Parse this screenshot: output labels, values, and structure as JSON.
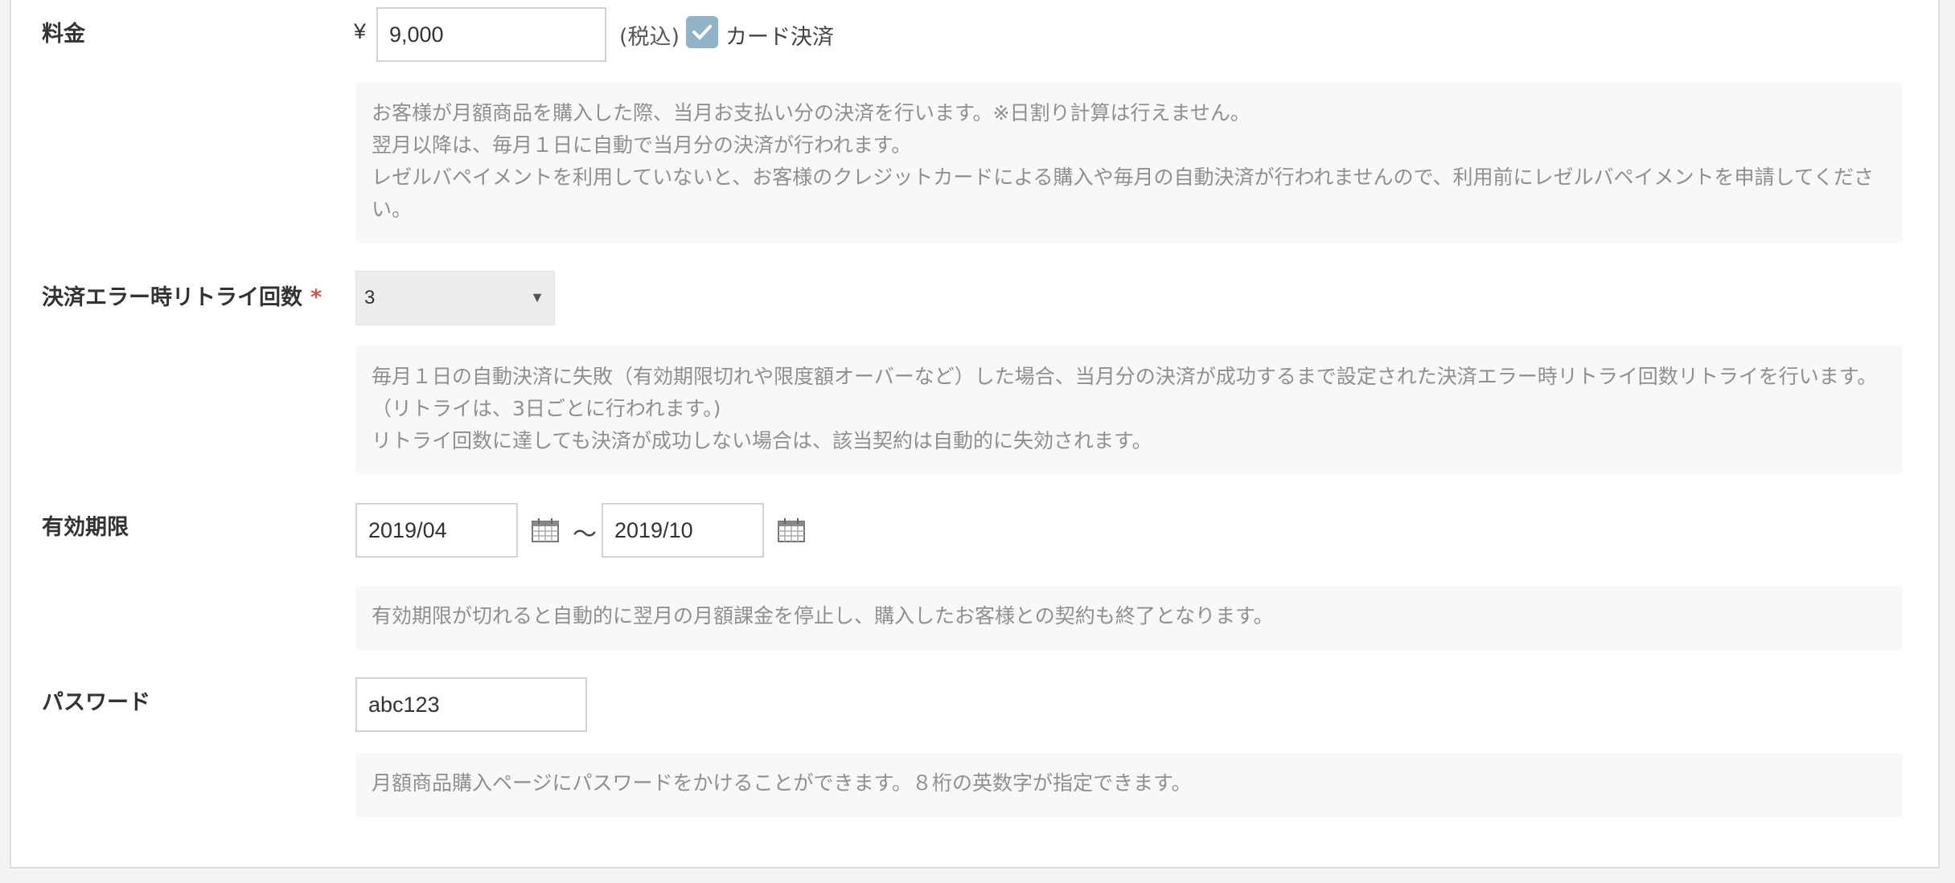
{
  "fee": {
    "label": "料金",
    "currency": "¥",
    "value": "9,000",
    "tax_note": "(税込)",
    "card_label": "カード決済",
    "card_checked": true,
    "help": [
      "お客様が月額商品を購入した際、当月お支払い分の決済を行います。※日割り計算は行えません。",
      "翌月以降は、毎月１日に自動で当月分の決済が行われます。",
      "レゼルバペイメントを利用していないと、お客様のクレジットカードによる購入や毎月の自動決済が行われませんので、利用前にレゼルバペイメントを申請してください。"
    ]
  },
  "retry": {
    "label": "決済エラー時リトライ回数",
    "required_mark": "*",
    "selected": "3",
    "help": [
      "毎月１日の自動決済に失敗（有効期限切れや限度額オーバーなど）した場合、当月分の決済が成功するまで設定された決済エラー時リトライ回数リトライを行います。（リトライは、3日ごとに行われます。)",
      "リトライ回数に達しても決済が成功しない場合は、該当契約は自動的に失効されます。"
    ]
  },
  "validity": {
    "label": "有効期限",
    "start": "2019/04",
    "separator": "～",
    "end": "2019/10",
    "help": [
      "有効期限が切れると自動的に翌月の月額課金を停止し、購入したお客様との契約も終了となります。"
    ]
  },
  "password": {
    "label": "パスワード",
    "value": "abc123",
    "help": [
      "月額商品購入ページにパスワードをかけることができます。８桁の英数字が指定できます。"
    ]
  },
  "colors": {
    "checkbox": "#8fb4c7",
    "required": "#d9534f",
    "help_bg": "#f8f8f8"
  }
}
